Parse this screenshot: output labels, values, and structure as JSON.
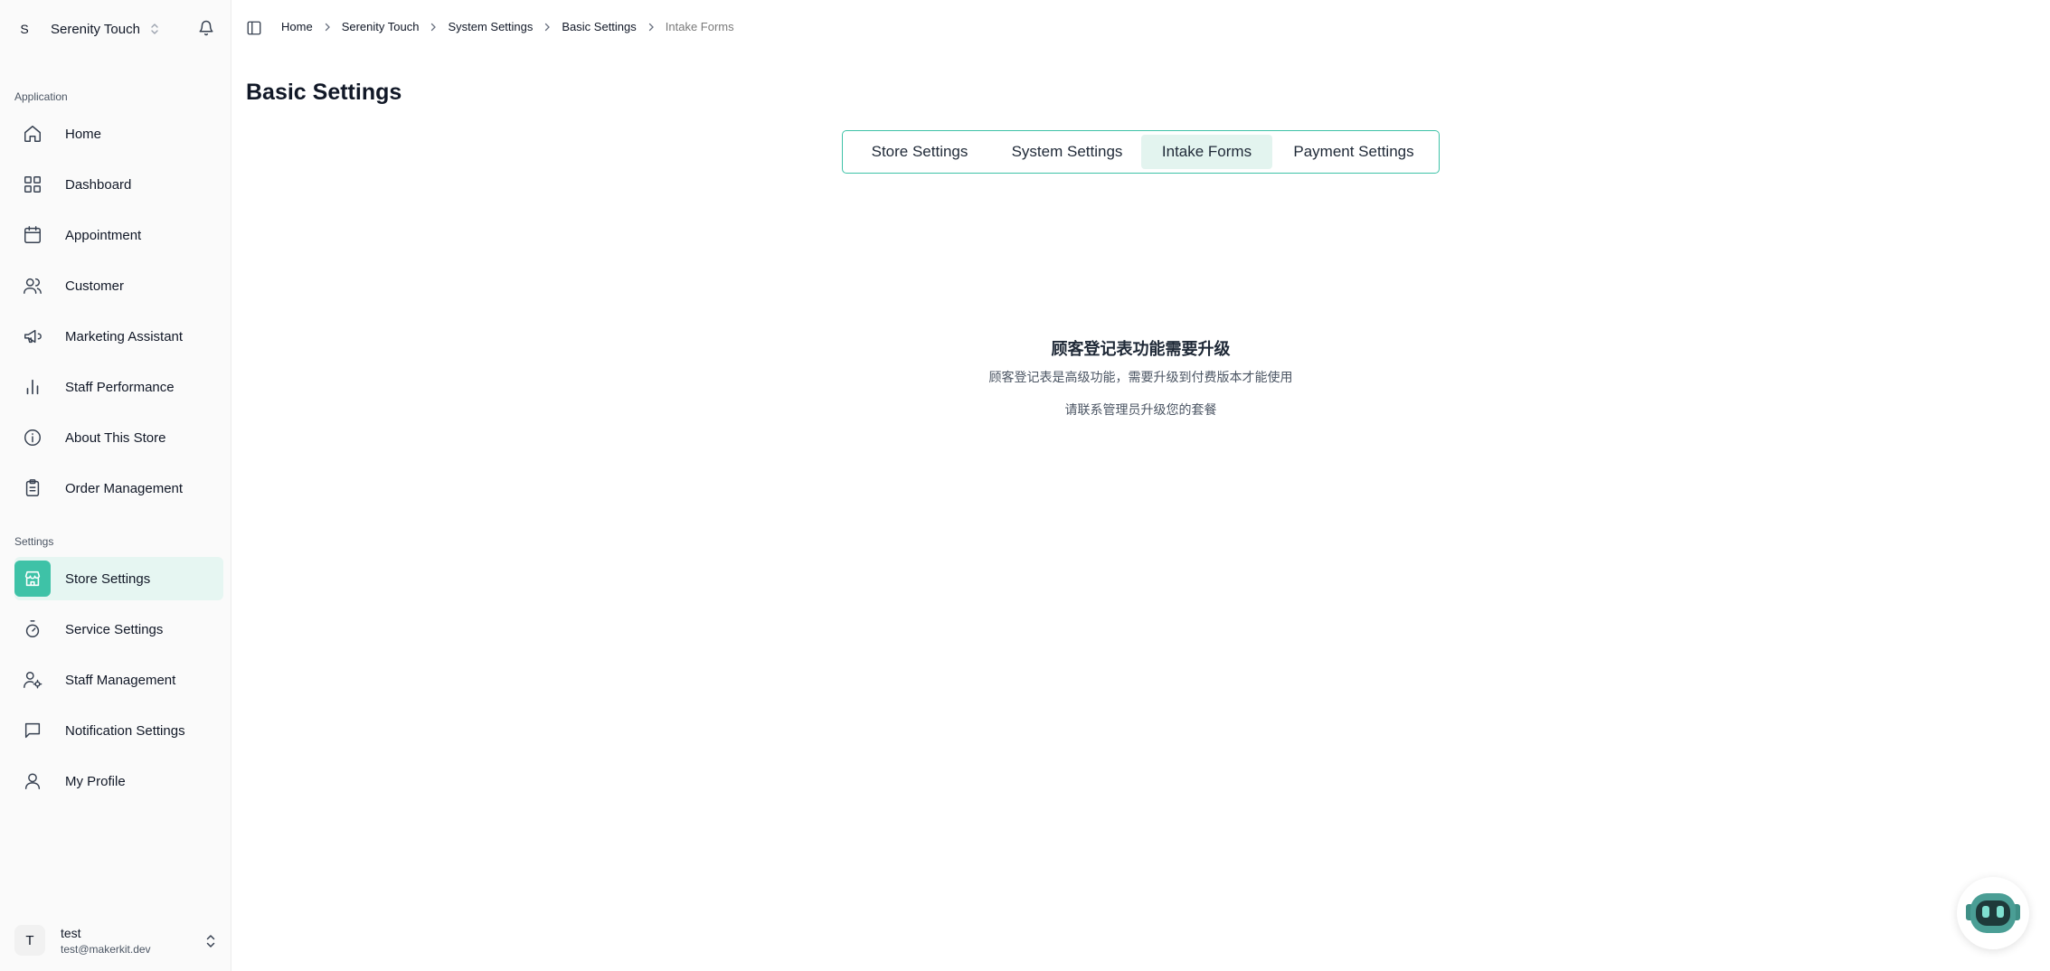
{
  "brand": {
    "initial": "S",
    "name": "Serenity Touch"
  },
  "sidebar": {
    "application_label": "Application",
    "application_items": [
      {
        "label": "Home",
        "icon": "home-icon"
      },
      {
        "label": "Dashboard",
        "icon": "grid-icon"
      },
      {
        "label": "Appointment",
        "icon": "calendar-icon"
      },
      {
        "label": "Customer",
        "icon": "users-icon"
      },
      {
        "label": "Marketing Assistant",
        "icon": "megaphone-icon"
      },
      {
        "label": "Staff Performance",
        "icon": "bar-chart-icon"
      },
      {
        "label": "About This Store",
        "icon": "info-icon"
      },
      {
        "label": "Order Management",
        "icon": "clipboard-icon"
      }
    ],
    "settings_label": "Settings",
    "settings_items": [
      {
        "label": "Store Settings",
        "icon": "store-icon",
        "active": true
      },
      {
        "label": "Service Settings",
        "icon": "timer-icon"
      },
      {
        "label": "Staff Management",
        "icon": "user-cog-icon"
      },
      {
        "label": "Notification Settings",
        "icon": "message-icon"
      },
      {
        "label": "My Profile",
        "icon": "user-icon"
      }
    ]
  },
  "user": {
    "initial": "T",
    "name": "test",
    "email": "test@makerkit.dev"
  },
  "breadcrumb": [
    "Home",
    "Serenity Touch",
    "System Settings",
    "Basic Settings",
    "Intake Forms"
  ],
  "page_title": "Basic Settings",
  "tabs": [
    "Store Settings",
    "System Settings",
    "Intake Forms",
    "Payment Settings"
  ],
  "active_tab": "Intake Forms",
  "notice": {
    "title": "顾客登记表功能需要升级",
    "line1": "顾客登记表是高级功能，需要升级到付费版本才能使用",
    "line2": "请联系管理员升级您的套餐"
  },
  "colors": {
    "accent": "#3ec2a7",
    "active_bg": "#e6f6f2",
    "robot": "#4a9e95"
  }
}
